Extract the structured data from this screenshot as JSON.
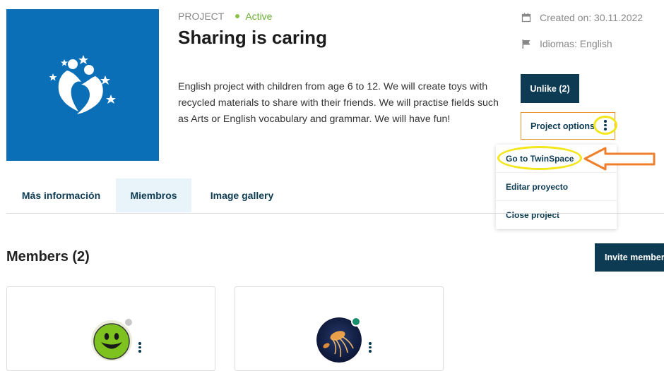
{
  "project": {
    "kicker": "PROJECT",
    "status": "Active",
    "title": "Sharing is caring",
    "description": "English project with children from age 6 to 12. We will create toys with recycled materials to share with their friends. We will practise fields such as Arts or English vocabulary and grammar. We will have fun!",
    "created": "Created on: 30.11.2022",
    "languages": "Idiomas: English"
  },
  "actions": {
    "unlike_label": "Unlike (2)",
    "options_label": "Project options"
  },
  "dropdown": {
    "items": [
      "Go to TwinSpace",
      "Editar proyecto",
      "Close project"
    ]
  },
  "tabs": [
    "Más información",
    "Miembros",
    "Image gallery"
  ],
  "members": {
    "heading": "Members (2)",
    "invite_label": "Invite member"
  },
  "colors": {
    "brand_dark": "#0c3b53",
    "project_image_bg": "#0b6fb8",
    "status_active": "#6aaf35",
    "annotation_yellow": "#f3e61b",
    "annotation_orange": "#f07f2c"
  }
}
